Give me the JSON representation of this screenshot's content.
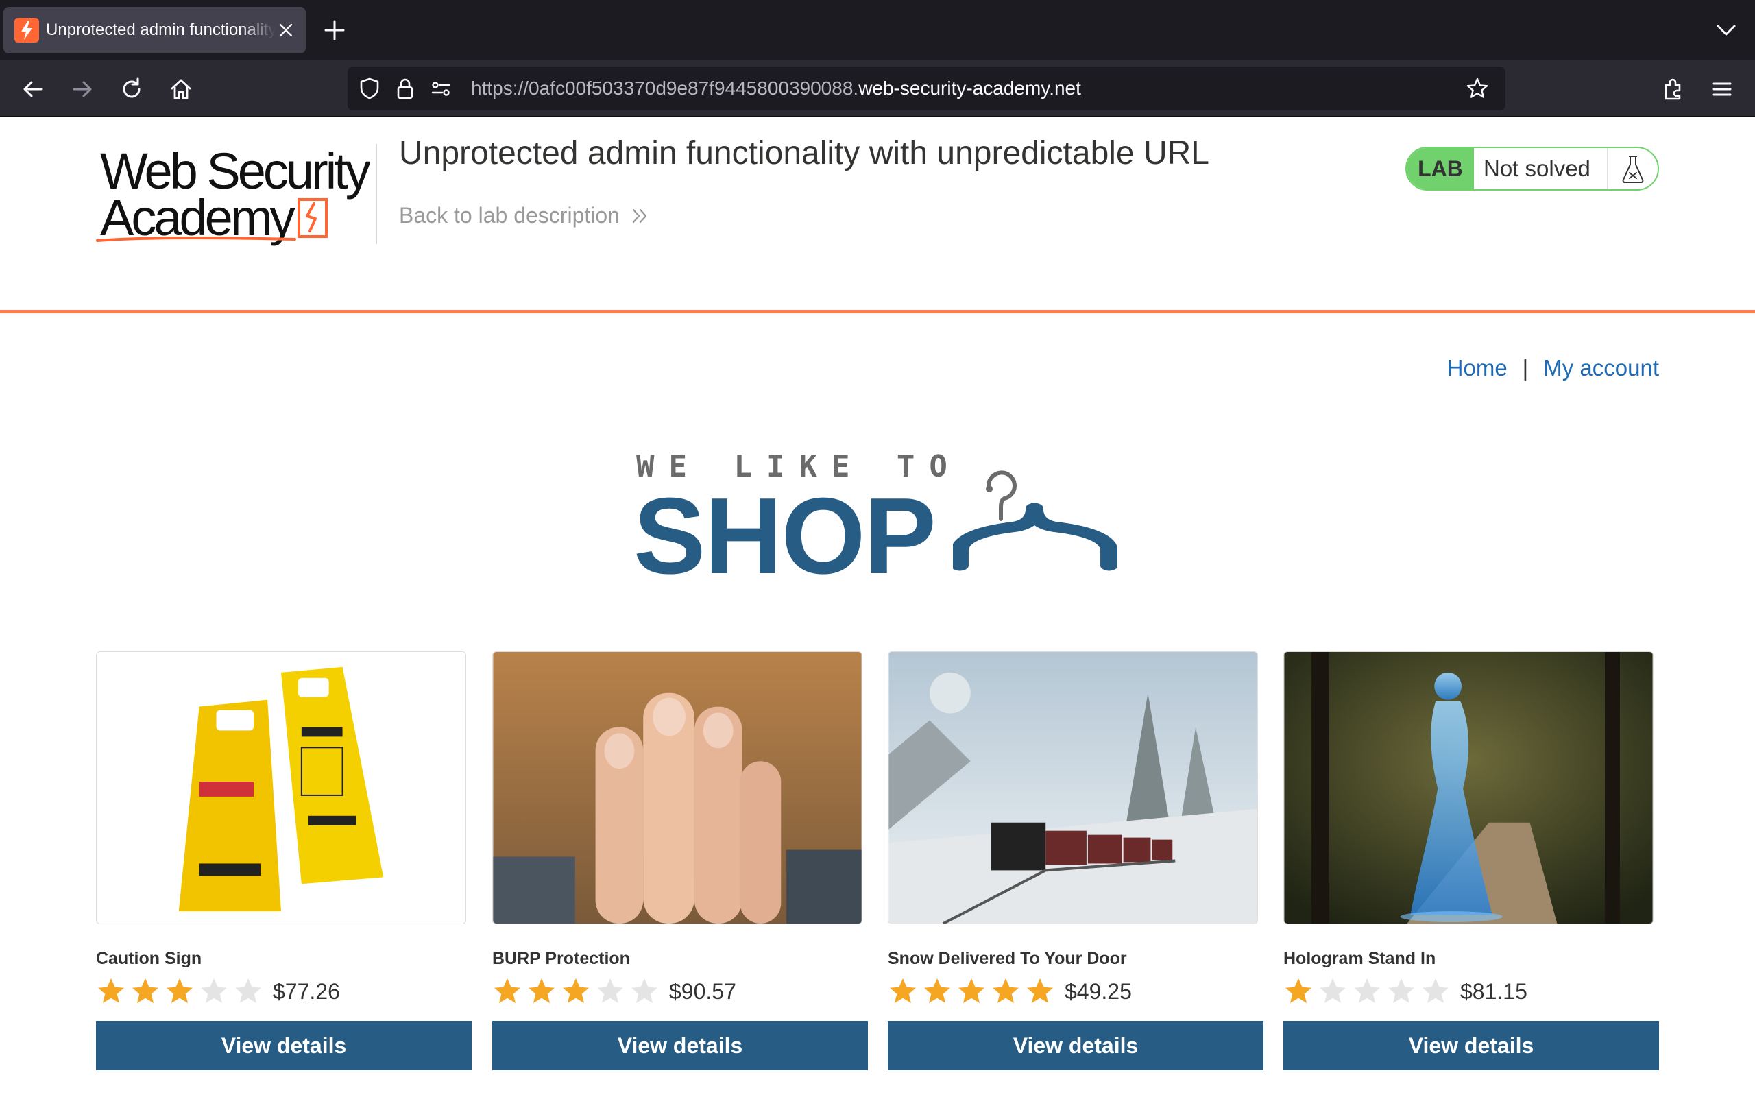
{
  "browser": {
    "tab_title": "Unprotected admin functionality with unpredictable URL",
    "url_prefix": "https://0afc00f503370d9e87f9445800390088.",
    "url_host": "web-security-academy.net"
  },
  "lab": {
    "logo_line1": "Web Security",
    "logo_line2": "Academy",
    "title": "Unprotected admin functionality with unpredictable URL",
    "back_link": "Back to lab description",
    "badge": "LAB",
    "status": "Not solved"
  },
  "nav": {
    "home": "Home",
    "separator": "|",
    "my_account": "My account"
  },
  "shop_logo": {
    "line1": "WE LIKE TO",
    "line2": "SHOP"
  },
  "products": [
    {
      "name": "Caution Sign",
      "rating": 3,
      "price": "$77.26",
      "button": "View details"
    },
    {
      "name": "BURP Protection",
      "rating": 3,
      "price": "$90.57",
      "button": "View details"
    },
    {
      "name": "Snow Delivered To Your Door",
      "rating": 5,
      "price": "$49.25",
      "button": "View details"
    },
    {
      "name": "Hologram Stand In",
      "rating": 1,
      "price": "$81.15",
      "button": "View details"
    }
  ],
  "colors": {
    "accent_orange": "#ff6633",
    "lab_green": "#70d16d",
    "shop_blue": "#275c85",
    "link_blue": "#1f6bb5",
    "star_filled": "#f5a623",
    "star_empty": "#e4e4e4"
  }
}
